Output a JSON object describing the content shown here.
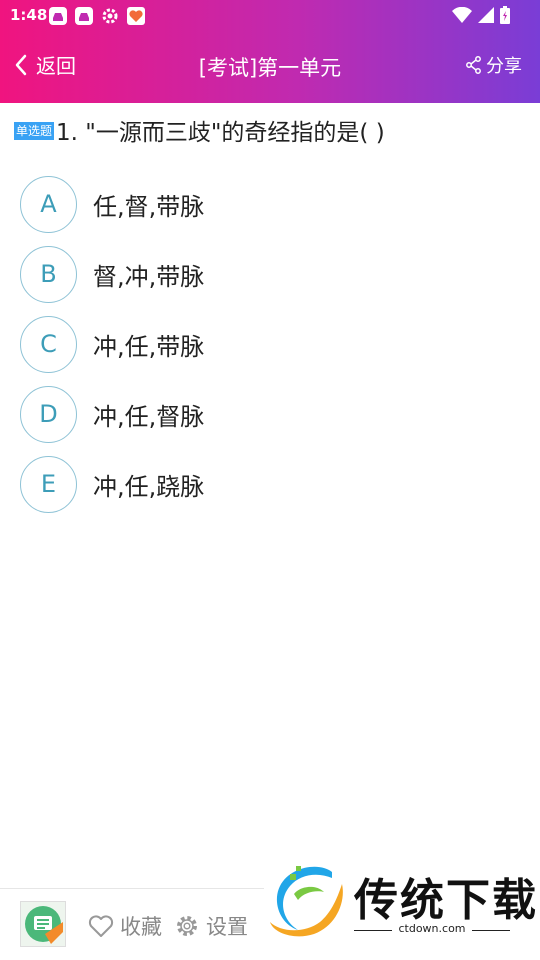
{
  "status_bar": {
    "time": "1:48",
    "icons": [
      "app-notification-icon",
      "app-notification-icon",
      "gear-icon",
      "health-app-icon",
      "wifi-icon",
      "signal-icon",
      "battery-charging-icon"
    ]
  },
  "nav": {
    "back_label": "返回",
    "title": "[考试]第一单元",
    "share_label": "分享"
  },
  "question": {
    "type_badge": "单选题",
    "text": "1. \"一源而三歧\"的奇经指的是( )"
  },
  "options": [
    {
      "letter": "A",
      "text": "任,督,带脉"
    },
    {
      "letter": "B",
      "text": "督,冲,带脉"
    },
    {
      "letter": "C",
      "text": "冲,任,带脉"
    },
    {
      "letter": "D",
      "text": "冲,任,督脉"
    },
    {
      "letter": "E",
      "text": "冲,任,跷脉"
    }
  ],
  "bottom_bar": {
    "favorite_label": "收藏",
    "settings_label": "设置"
  },
  "watermark": {
    "brand": "传统下载",
    "site": "ctdown.com"
  },
  "colors": {
    "header_gradient_start": "#f0147f",
    "header_gradient_end": "#7a3dd6",
    "option_letter": "#3d9db8",
    "badge": "#39a2f4"
  }
}
